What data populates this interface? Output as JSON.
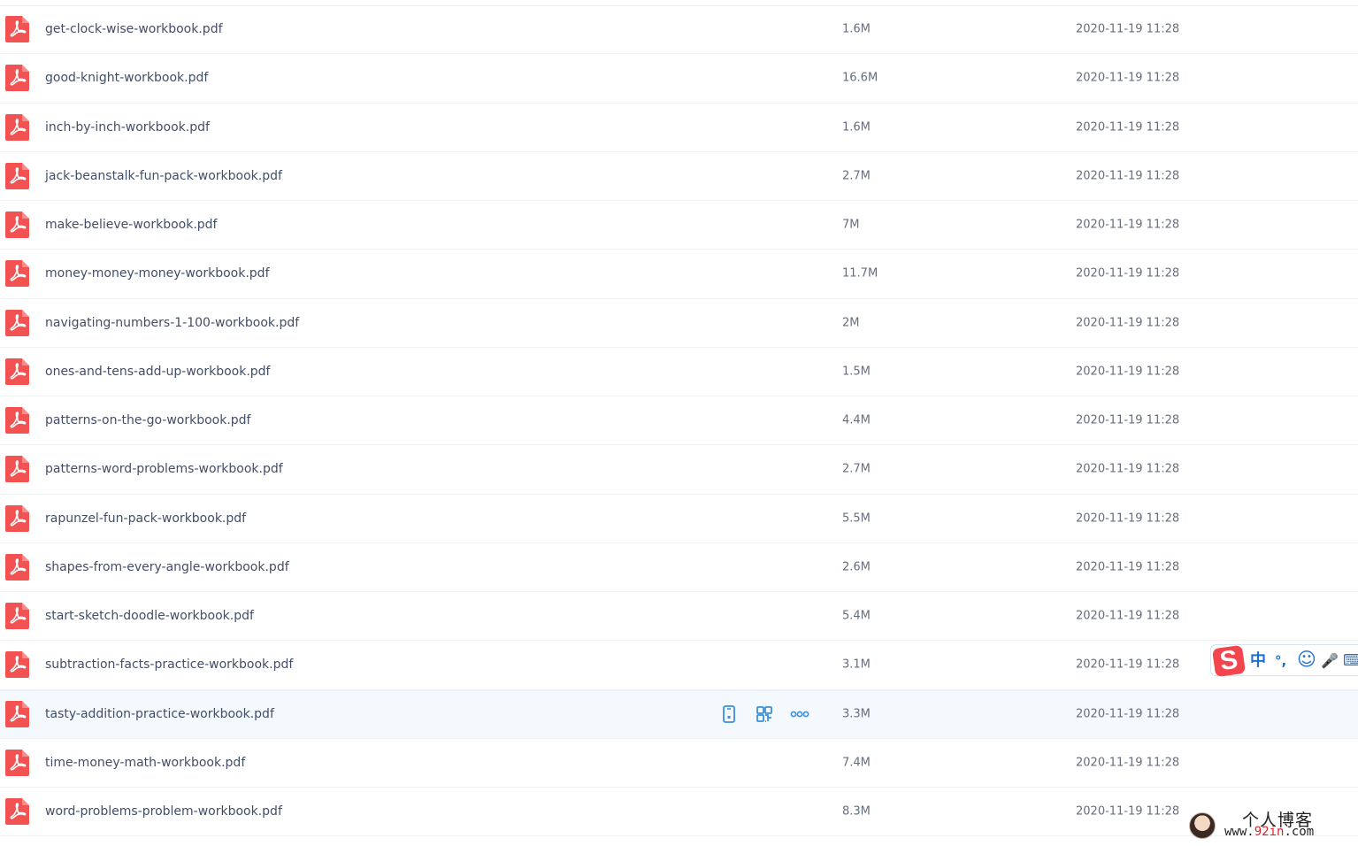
{
  "files": [
    {
      "name": "get-clock-wise-workbook.pdf",
      "size": "1.6M",
      "modified": "2020-11-19 11:28"
    },
    {
      "name": "good-knight-workbook.pdf",
      "size": "16.6M",
      "modified": "2020-11-19 11:28"
    },
    {
      "name": "inch-by-inch-workbook.pdf",
      "size": "1.6M",
      "modified": "2020-11-19 11:28"
    },
    {
      "name": "jack-beanstalk-fun-pack-workbook.pdf",
      "size": "2.7M",
      "modified": "2020-11-19 11:28"
    },
    {
      "name": "make-believe-workbook.pdf",
      "size": "7M",
      "modified": "2020-11-19 11:28"
    },
    {
      "name": "money-money-money-workbook.pdf",
      "size": "11.7M",
      "modified": "2020-11-19 11:28"
    },
    {
      "name": "navigating-numbers-1-100-workbook.pdf",
      "size": "2M",
      "modified": "2020-11-19 11:28"
    },
    {
      "name": "ones-and-tens-add-up-workbook.pdf",
      "size": "1.5M",
      "modified": "2020-11-19 11:28"
    },
    {
      "name": "patterns-on-the-go-workbook.pdf",
      "size": "4.4M",
      "modified": "2020-11-19 11:28"
    },
    {
      "name": "patterns-word-problems-workbook.pdf",
      "size": "2.7M",
      "modified": "2020-11-19 11:28"
    },
    {
      "name": "rapunzel-fun-pack-workbook.pdf",
      "size": "5.5M",
      "modified": "2020-11-19 11:28"
    },
    {
      "name": "shapes-from-every-angle-workbook.pdf",
      "size": "2.6M",
      "modified": "2020-11-19 11:28"
    },
    {
      "name": "start-sketch-doodle-workbook.pdf",
      "size": "5.4M",
      "modified": "2020-11-19 11:28"
    },
    {
      "name": "subtraction-facts-practice-workbook.pdf",
      "size": "3.1M",
      "modified": "2020-11-19 11:28"
    },
    {
      "name": "tasty-addition-practice-workbook.pdf",
      "size": "3.3M",
      "modified": "2020-11-19 11:28",
      "hovered": true
    },
    {
      "name": "time-money-math-workbook.pdf",
      "size": "7.4M",
      "modified": "2020-11-19 11:28"
    },
    {
      "name": "word-problems-problem-workbook.pdf",
      "size": "8.3M",
      "modified": "2020-11-19 11:28"
    }
  ],
  "row_actions": [
    {
      "icon": "phone-icon"
    },
    {
      "icon": "qr-code-icon"
    },
    {
      "icon": "more-icon"
    }
  ],
  "ime_toolbar": {
    "logo": "S",
    "lang": "中",
    "punct": "°,",
    "emoji": "☺",
    "voice": "🎤",
    "keyboard": "⌨"
  },
  "watermark": {
    "title": "个人博客",
    "url_prefix": "www.",
    "url_accent": "92in",
    "url_suffix": ".com"
  },
  "colors": {
    "pdf_icon": "#f25252",
    "action_icon": "#3a8fdc",
    "row_hover": "#f4f9fe",
    "filename_text": "#424e67",
    "meta_text": "#666e7c"
  }
}
